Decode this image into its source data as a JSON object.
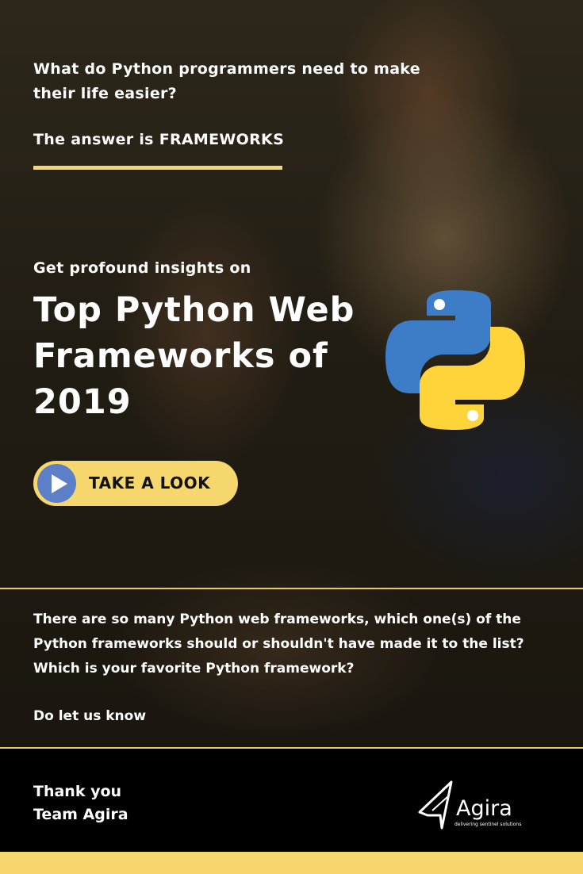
{
  "hero": {
    "intro": "What do Python programmers need to make their life easier?",
    "answer": "The answer is FRAMEWORKS",
    "insights": "Get profound insights on",
    "headline": "Top Python Web Frameworks of 2019",
    "cta_label": "TAKE A LOOK"
  },
  "question": {
    "line1": "There are so many Python web frameworks, which one(s) of the Python frameworks should or shouldn't have made it to the list?",
    "line2": "Which is your favorite Python framework?",
    "follow_up": "Do let us know"
  },
  "footer": {
    "thank_you": "Thank you",
    "team": "Team Agira",
    "brand_name": "Agira",
    "brand_tagline": "delivering sentinel solutions"
  },
  "colors": {
    "accent_yellow": "#f5d76e",
    "python_blue": "#3d7dc8",
    "python_yellow": "#ffd43b",
    "play_blue": "#5c7fc7"
  },
  "icons": [
    "python-logo-icon",
    "play-icon",
    "agira-logo-icon"
  ]
}
